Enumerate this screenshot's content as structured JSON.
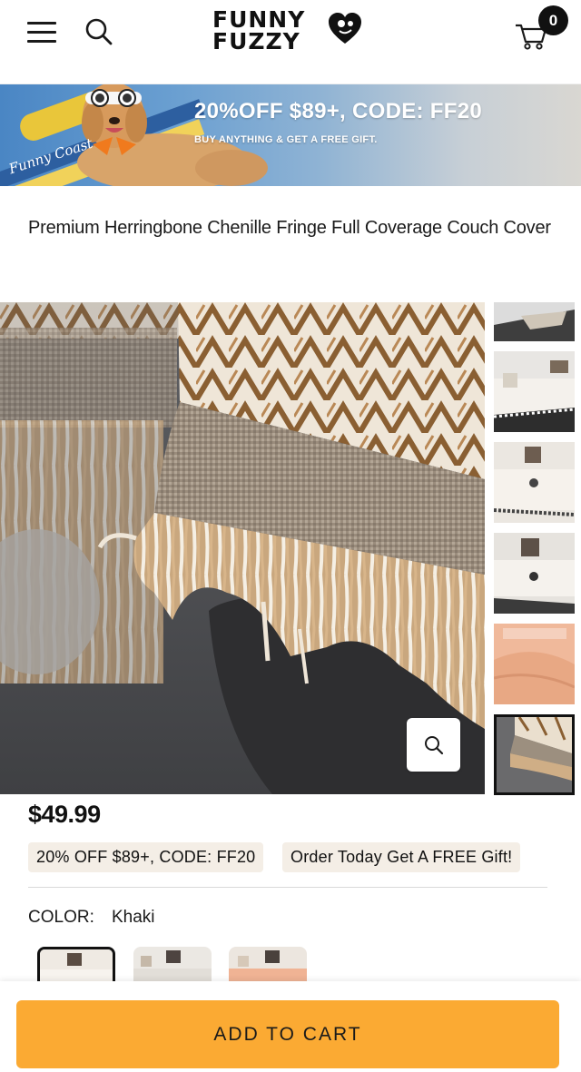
{
  "header": {
    "logo_line1": "FUNNY",
    "logo_line2": "FUZZY",
    "cart_count": "0",
    "icons": [
      "menu-icon",
      "search-icon",
      "heart-logo-icon",
      "cart-icon"
    ]
  },
  "banner": {
    "title": "20%OFF $89+, CODE: FF20",
    "subtitle": "BUY ANYTHING & GET A FREE GIFT.",
    "script_text": "Funny Coast"
  },
  "product": {
    "title": "Premium Herringbone Chenille Fringe Full Coverage Couch Cover",
    "price": "$49.99",
    "promo_tags": [
      "20% OFF $89+, CODE: FF20",
      "Order Today Get A FREE Gift!"
    ],
    "color_label": "COLOR:",
    "color_value": "Khaki",
    "thumbnail_count": 6,
    "active_thumbnail": 6,
    "swatches": [
      "khaki",
      "grey",
      "pink"
    ]
  },
  "cta": {
    "add_to_cart": "ADD TO CART"
  },
  "colors": {
    "accent": "#fbaa33",
    "tag_bg": "#f4eee6",
    "text": "#1a1a1a"
  }
}
